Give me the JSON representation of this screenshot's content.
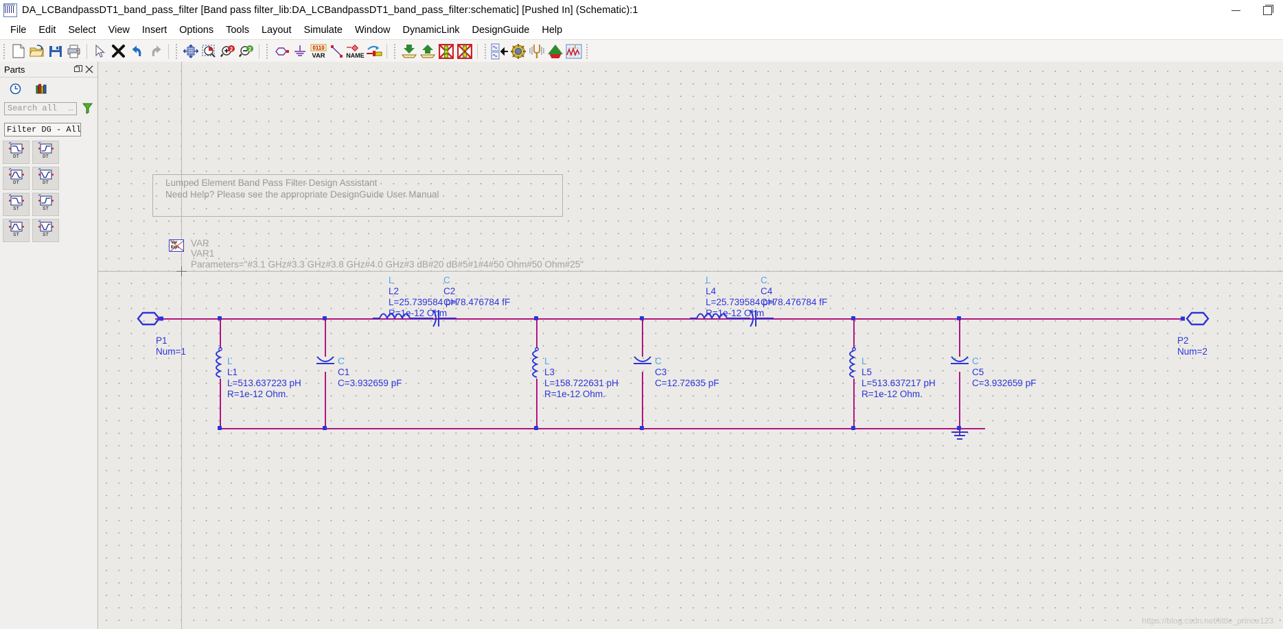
{
  "window": {
    "title": "DA_LCBandpassDT1_band_pass_filter [Band pass filter_lib:DA_LCBandpassDT1_band_pass_filter:schematic] [Pushed In] (Schematic):1",
    "app_icon": "waveform-icon",
    "minimize": "─",
    "maximize": "❐",
    "close": "✕"
  },
  "menubar": {
    "items": [
      {
        "label": "File"
      },
      {
        "label": "Edit"
      },
      {
        "label": "Select"
      },
      {
        "label": "View"
      },
      {
        "label": "Insert"
      },
      {
        "label": "Options"
      },
      {
        "label": "Tools"
      },
      {
        "label": "Layout"
      },
      {
        "label": "Simulate"
      },
      {
        "label": "Window"
      },
      {
        "label": "DynamicLink"
      },
      {
        "label": "DesignGuide"
      },
      {
        "label": "Help"
      }
    ]
  },
  "toolbar": {
    "groups": [
      {
        "buttons": [
          {
            "icon": "new-document-icon",
            "tip": "New"
          },
          {
            "icon": "open-folder-icon",
            "tip": "Open"
          },
          {
            "icon": "save-floppy-icon",
            "tip": "Save"
          },
          {
            "icon": "print-icon",
            "tip": "Print"
          }
        ]
      },
      {
        "buttons": [
          {
            "icon": "cursor-arrow-icon",
            "tip": "Select"
          },
          {
            "icon": "delete-x-icon",
            "tip": "Delete"
          },
          {
            "icon": "undo-arrow-icon",
            "tip": "Undo"
          },
          {
            "icon": "redo-arrow-icon",
            "tip": "Redo"
          }
        ]
      },
      {
        "buttons": [
          {
            "icon": "zoom-fit-icon",
            "tip": "View All"
          },
          {
            "icon": "zoom-area-icon",
            "tip": "Zoom Area"
          },
          {
            "icon": "zoom-in-icon",
            "tip": "Zoom In"
          },
          {
            "icon": "zoom-out-icon",
            "tip": "Zoom Out"
          }
        ]
      },
      {
        "buttons": [
          {
            "icon": "port-symbol-icon",
            "tip": "Port"
          },
          {
            "icon": "ground-symbol-icon",
            "tip": "Ground"
          },
          {
            "icon": "var-equation-icon",
            "tip": "VAR Equation",
            "text": "0110 VAR"
          },
          {
            "icon": "wire-icon",
            "tip": "Insert Wire"
          },
          {
            "icon": "wire-name-icon",
            "tip": "Wire/Pin Label",
            "text": "NAME"
          },
          {
            "icon": "pin-connect-icon",
            "tip": "Insert Pin"
          }
        ]
      },
      {
        "buttons": [
          {
            "icon": "push-into-icon",
            "tip": "Push Into Hierarchy"
          },
          {
            "icon": "pop-out-icon",
            "tip": "Pop Out"
          },
          {
            "icon": "deactivate-component-icon",
            "tip": "Deactivate"
          },
          {
            "icon": "activate-component-icon",
            "tip": "Activate"
          }
        ]
      },
      {
        "buttons": [
          {
            "icon": "component-library-icon",
            "tip": "Component Library"
          },
          {
            "icon": "optimization-gear-icon",
            "tip": "Optimization"
          },
          {
            "icon": "tuning-fork-icon",
            "tip": "Tune Parameters"
          },
          {
            "icon": "simulate-arrow-icon",
            "tip": "Simulate"
          },
          {
            "icon": "data-display-icon",
            "tip": "New Data Display"
          }
        ]
      }
    ]
  },
  "parts_panel": {
    "title": "Parts",
    "float_icon": "restore-panel-icon",
    "close_icon": "close-icon",
    "tabs": [
      {
        "icon": "history-clock-icon",
        "name": "history"
      },
      {
        "icon": "library-books-icon",
        "name": "library"
      }
    ],
    "search": {
      "placeholder": "Search all",
      "value": "",
      "ellipsis": "…"
    },
    "filter_icon": "funnel-filter-icon",
    "filter_select": {
      "value": "Filter DG - All",
      "caret": "⌄"
    },
    "parts": [
      {
        "label": "DT",
        "symbol": "lowpass-filter-icon"
      },
      {
        "label": "DT",
        "symbol": "highpass-filter-icon"
      },
      {
        "label": "DT",
        "symbol": "bandpass-filter-icon"
      },
      {
        "label": "DT",
        "symbol": "bandstop-filter-icon"
      },
      {
        "label": "ST",
        "symbol": "lowpass-filter-icon"
      },
      {
        "label": "ST",
        "symbol": "highpass-filter-icon"
      },
      {
        "label": "ST",
        "symbol": "bandpass-filter-icon"
      },
      {
        "label": "ST",
        "symbol": "bandstop-filter-icon"
      }
    ]
  },
  "schematic": {
    "note": {
      "line1": "Lumped Element Band Pass Filter Design Assistant",
      "line2": "Need Help?  Please see the appropriate DesignGuide User Manual"
    },
    "var_block": {
      "icon": "var-eqn-icon",
      "type": "VAR",
      "name": "VAR1",
      "parameters": "Parameters=\"#3.1 GHz#3.3 GHz#3.8 GHz#4.0 GHz#3 dB#20 dB#5#1#4#50 Ohm#50 Ohm#25\""
    },
    "ports": [
      {
        "name": "P1",
        "num": "Num=1"
      },
      {
        "name": "P2",
        "num": "Num=2"
      }
    ],
    "components": [
      {
        "id": "L1",
        "type": "L",
        "orientation": "shunt",
        "value": "L=513.637223 pH",
        "resistance": "R=1e-12 Ohm."
      },
      {
        "id": "C1",
        "type": "C",
        "orientation": "shunt",
        "value": "C=3.932659 pF",
        "resistance": ""
      },
      {
        "id": "L2",
        "type": "L",
        "orientation": "series",
        "value": "L=25.739584 pH",
        "resistance": "R=1e-12 Ohm"
      },
      {
        "id": "C2",
        "type": "C",
        "orientation": "series",
        "value": "C=78.476784 fF",
        "resistance": ""
      },
      {
        "id": "L3",
        "type": "L",
        "orientation": "shunt",
        "value": "L=158.722631 pH",
        "resistance": "R=1e-12 Ohm."
      },
      {
        "id": "C3",
        "type": "C",
        "orientation": "shunt",
        "value": "C=12.72635 pF",
        "resistance": ""
      },
      {
        "id": "L4",
        "type": "L",
        "orientation": "series",
        "value": "L=25.739584 pH",
        "resistance": "R=1e-12 Ohm"
      },
      {
        "id": "C4",
        "type": "C",
        "orientation": "series",
        "value": "C=78.476784 fF",
        "resistance": ""
      },
      {
        "id": "L5",
        "type": "L",
        "orientation": "shunt",
        "value": "L=513.637217 pH",
        "resistance": "R=1e-12 Ohm."
      },
      {
        "id": "C5",
        "type": "C",
        "orientation": "shunt",
        "value": "C=3.932659 pF",
        "resistance": ""
      }
    ],
    "ground_icon": "ground-symbol-icon",
    "watermark": "https://blog.csdn.net/little_prince123"
  },
  "colors": {
    "wire": "#b0157f",
    "component": "#2b34d8",
    "component_type": "#4aa7e8",
    "canvas_bg": "#eceae7",
    "panel_bg": "#f0efed",
    "toolbar_bg": "#f5f4f2"
  }
}
